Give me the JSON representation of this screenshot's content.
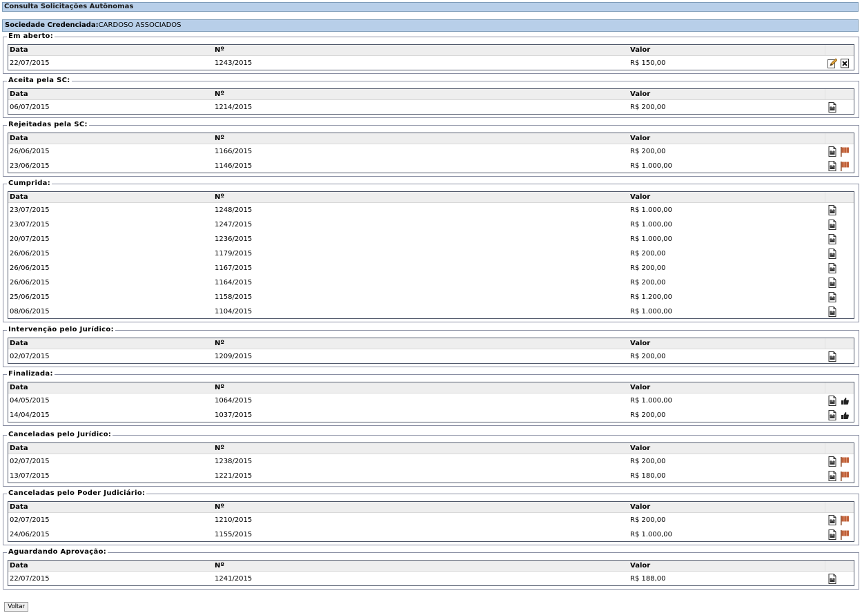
{
  "page_title": "Consulta Solicitações Autônomas",
  "sociedade": {
    "label": "Sociedade Credenciada:",
    "value": "CARDOSO ASSOCIADOS"
  },
  "columns": {
    "data": "Data",
    "numero": "Nº",
    "valor": "Valor"
  },
  "groups": [
    {
      "label": "Em aberto:",
      "rows": [
        {
          "data": "22/07/2015",
          "numero": "1243/2015",
          "valor": "R$ 150,00",
          "actions": [
            "edit-icon",
            "delete-icon"
          ]
        }
      ]
    },
    {
      "label": "Aceita pela SC:",
      "rows": [
        {
          "data": "06/07/2015",
          "numero": "1214/2015",
          "valor": "R$ 200,00",
          "actions": [
            "view-document-icon"
          ]
        }
      ]
    },
    {
      "label": "Rejeitadas pela SC:",
      "rows": [
        {
          "data": "26/06/2015",
          "numero": "1166/2015",
          "valor": "R$ 200,00",
          "actions": [
            "view-document-icon",
            "flag-icon"
          ]
        },
        {
          "data": "23/06/2015",
          "numero": "1146/2015",
          "valor": "R$ 1.000,00",
          "actions": [
            "view-document-icon",
            "flag-icon"
          ]
        }
      ]
    },
    {
      "label": "Cumprida:",
      "rows": [
        {
          "data": "23/07/2015",
          "numero": "1248/2015",
          "valor": "R$ 1.000,00",
          "actions": [
            "view-document-icon"
          ]
        },
        {
          "data": "23/07/2015",
          "numero": "1247/2015",
          "valor": "R$ 1.000,00",
          "actions": [
            "view-document-icon"
          ]
        },
        {
          "data": "20/07/2015",
          "numero": "1236/2015",
          "valor": "R$ 1.000,00",
          "actions": [
            "view-document-icon"
          ]
        },
        {
          "data": "26/06/2015",
          "numero": "1179/2015",
          "valor": "R$ 200,00",
          "actions": [
            "view-document-icon"
          ]
        },
        {
          "data": "26/06/2015",
          "numero": "1167/2015",
          "valor": "R$ 200,00",
          "actions": [
            "view-document-icon"
          ]
        },
        {
          "data": "26/06/2015",
          "numero": "1164/2015",
          "valor": "R$ 200,00",
          "actions": [
            "view-document-icon"
          ]
        },
        {
          "data": "25/06/2015",
          "numero": "1158/2015",
          "valor": "R$ 1.200,00",
          "actions": [
            "view-document-icon"
          ]
        },
        {
          "data": "08/06/2015",
          "numero": "1104/2015",
          "valor": "R$ 1.000,00",
          "actions": [
            "view-document-icon"
          ]
        }
      ]
    },
    {
      "label": "Intervenção pelo Jurídico:",
      "rows": [
        {
          "data": "02/07/2015",
          "numero": "1209/2015",
          "valor": "R$ 200,00",
          "actions": [
            "view-document-icon"
          ]
        }
      ]
    },
    {
      "label": "Finalizada:",
      "rows": [
        {
          "data": "04/05/2015",
          "numero": "1064/2015",
          "valor": "R$ 1.000,00",
          "actions": [
            "view-document-icon",
            "thumbs-up-icon"
          ]
        },
        {
          "data": "14/04/2015",
          "numero": "1037/2015",
          "valor": "R$ 200,00",
          "actions": [
            "view-document-icon",
            "thumbs-up-icon"
          ]
        }
      ]
    },
    {
      "label": "Canceladas pelo Jurídico:",
      "rows": [
        {
          "data": "02/07/2015",
          "numero": "1238/2015",
          "valor": "R$ 200,00",
          "actions": [
            "view-document-icon",
            "flag-icon"
          ]
        },
        {
          "data": "13/07/2015",
          "numero": "1221/2015",
          "valor": "R$ 180,00",
          "actions": [
            "view-document-icon",
            "flag-icon"
          ]
        }
      ]
    },
    {
      "label": "Canceladas pelo Poder Judiciário:",
      "rows": [
        {
          "data": "02/07/2015",
          "numero": "1210/2015",
          "valor": "R$ 200,00",
          "actions": [
            "view-document-icon",
            "flag-icon"
          ]
        },
        {
          "data": "24/06/2015",
          "numero": "1155/2015",
          "valor": "R$ 1.000,00",
          "actions": [
            "view-document-icon",
            "flag-icon"
          ]
        }
      ]
    },
    {
      "label": "Aguardando Aprovação:",
      "rows": [
        {
          "data": "22/07/2015",
          "numero": "1241/2015",
          "valor": "R$ 188,00",
          "actions": [
            "view-document-icon"
          ]
        }
      ]
    }
  ],
  "buttons": {
    "voltar": "Voltar"
  },
  "colors": {
    "header_bg": "#b8cfe9",
    "table_border": "#51596b",
    "thead_bg": "#eeeeee",
    "flag": "#c0613a"
  }
}
